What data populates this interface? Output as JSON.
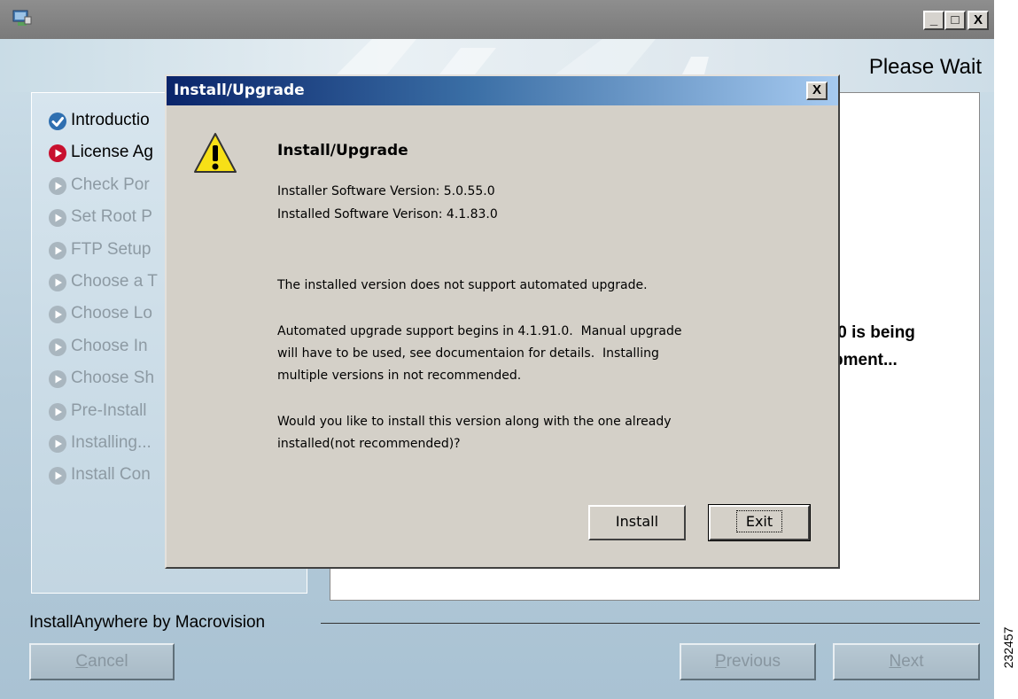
{
  "window": {
    "title_buttons": {
      "minimize": "_",
      "maximize": "□",
      "close": "X"
    },
    "banner_title": "Please Wait"
  },
  "steps": [
    {
      "label": "Introductio",
      "state": "done"
    },
    {
      "label": "License Ag",
      "state": "current"
    },
    {
      "label": "Check Por",
      "state": "pending"
    },
    {
      "label": "Set Root P",
      "state": "pending"
    },
    {
      "label": "FTP Setup",
      "state": "pending"
    },
    {
      "label": "Choose a T",
      "state": "pending"
    },
    {
      "label": "Choose Lo",
      "state": "pending"
    },
    {
      "label": "Choose In",
      "state": "pending"
    },
    {
      "label": "Choose Sh",
      "state": "pending"
    },
    {
      "label": "Pre-Install",
      "state": "pending"
    },
    {
      "label": "Installing...",
      "state": "pending"
    },
    {
      "label": "Install Con",
      "state": "pending"
    }
  ],
  "content": {
    "line1": ".0 is being",
    "line2": "pment..."
  },
  "footer": {
    "vendor": "InstallAnywhere by Macrovision",
    "cancel_rest": "ancel",
    "cancel_mnemonic": "C",
    "previous_mnemonic": "P",
    "previous_rest": "revious",
    "next_mnemonic": "N",
    "next_rest": "ext"
  },
  "figure_id": "232457",
  "dialog": {
    "title": "Install/Upgrade",
    "close": "X",
    "heading": "Install/Upgrade",
    "installer_version": "Installer Software Version: 5.0.55.0",
    "installed_version": "Installed Software Verison: 4.1.83.0",
    "message1": "The installed version does not support automated upgrade.",
    "message2_l1": "Automated upgrade support begins in 4.1.91.0.  Manual upgrade",
    "message2_l2": "will have to be used, see documentaion for details.  Installing",
    "message2_l3": "multiple versions in not recommended.",
    "question_l1": "Would you like to install this version along with the one already",
    "question_l2": "installed(not recommended)?",
    "install_label": "Install",
    "exit_label": "Exit"
  },
  "colors": {
    "dialog_title_start": "#0a246a",
    "dialog_face": "#d4d0c8",
    "step_done": "#2f6fb0",
    "step_current": "#c8102e",
    "step_pending": "#a9b6bf"
  },
  "icons": {
    "app": "installer-app-icon",
    "done": "check-circle-icon",
    "current": "play-circle-icon",
    "pending": "play-circle-icon",
    "warning": "warning-icon"
  }
}
